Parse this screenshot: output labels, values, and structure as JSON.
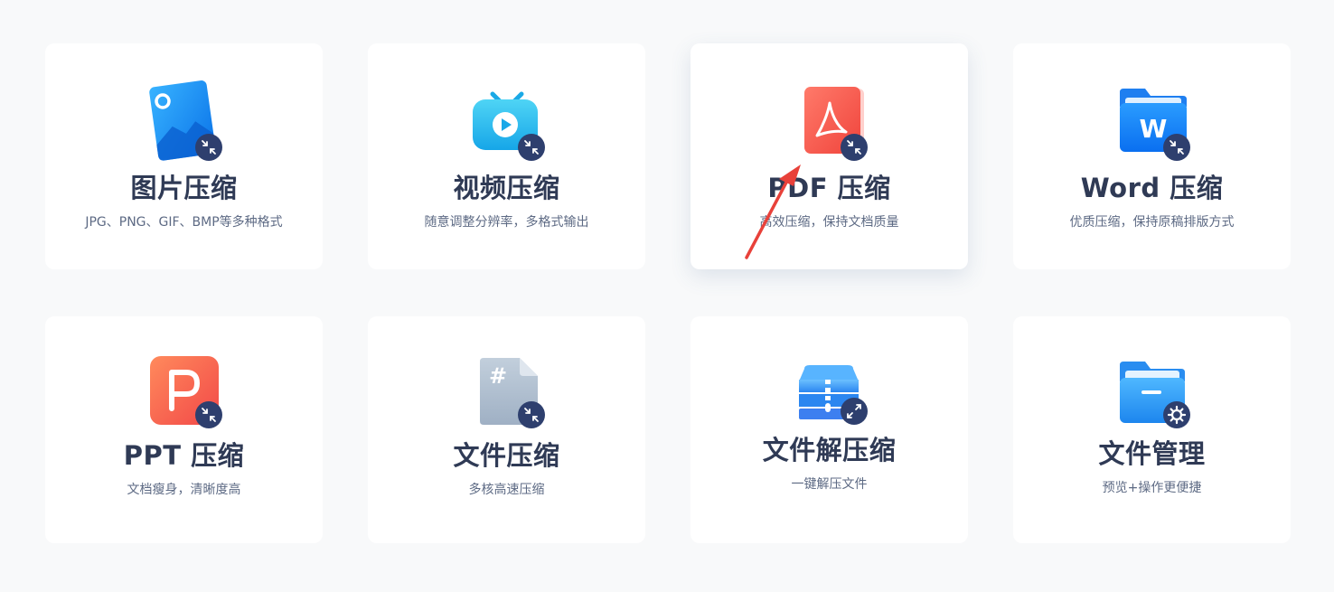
{
  "tools": [
    {
      "title": "图片压缩",
      "subtitle": "JPG、PNG、GIF、BMP等多种格式",
      "icon": "image-compress-icon"
    },
    {
      "title": "视频压缩",
      "subtitle": "随意调整分辨率，多格式输出",
      "icon": "video-compress-icon"
    },
    {
      "title": "PDF 压缩",
      "subtitle": "高效压缩，保持文档质量",
      "icon": "pdf-compress-icon"
    },
    {
      "title": "Word 压缩",
      "subtitle": "优质压缩，保持原稿排版方式",
      "icon": "word-compress-icon"
    },
    {
      "title": "PPT 压缩",
      "subtitle": "文档瘦身，清晰度高",
      "icon": "ppt-compress-icon"
    },
    {
      "title": "文件压缩",
      "subtitle": "多核高速压缩",
      "icon": "file-compress-icon"
    },
    {
      "title": "文件解压缩",
      "subtitle": "一键解压文件",
      "icon": "file-decompress-icon"
    },
    {
      "title": "文件管理",
      "subtitle": "预览+操作更便捷",
      "icon": "file-manage-icon"
    }
  ],
  "colors": {
    "background": "#f8f9fa",
    "card": "#ffffff",
    "title": "#2f3a55",
    "subtitle": "#5d6a84",
    "badge": "#2e3f6e",
    "annotation_arrow": "#e8413a"
  }
}
